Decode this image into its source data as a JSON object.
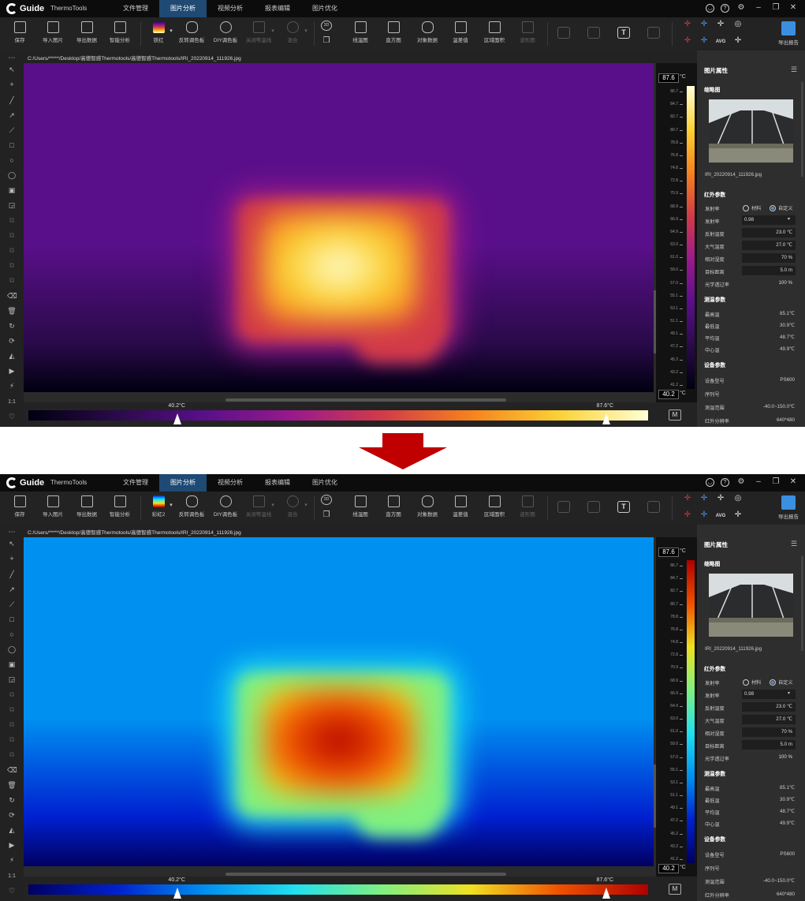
{
  "window": {
    "logo_text": "Guide",
    "app_name": "ThermoTools",
    "menu": [
      "文件管理",
      "图片分析",
      "视频分析",
      "报表编辑",
      "图片优化"
    ],
    "active_menu": 1
  },
  "toolbar": {
    "save": "保存",
    "import_image": "导入图片",
    "export_data": "导出数据",
    "smart_analysis": "智能分析",
    "invert_palette": "反转调色板",
    "diy_palette": "DIY调色板",
    "isotherm_off": "关闭等温线",
    "blend": "混合",
    "line_temp": "线温图",
    "histogram": "直方图",
    "object_data": "对象数据",
    "temp_diff": "温差值",
    "region_area": "区域面积",
    "waveform": "波形图",
    "avg_label": "AVG",
    "export_report": "导出报告",
    "icons": [
      "save-icon",
      "image-icon",
      "export-data-icon",
      "smart-analysis-icon",
      "invert-palette-icon",
      "diy-palette-icon",
      "isotherm-icon",
      "blend-icon",
      "3d-icon",
      "line-chart-icon",
      "histogram-icon",
      "database-icon",
      "delta-t-icon",
      "area-icon",
      "waveform-icon",
      "comment-icon",
      "image-frame-icon",
      "text-icon",
      "bookmark-icon",
      "crosshair-max-icon",
      "crosshair-min-icon",
      "crosshair-center-icon",
      "crosshair-min-max-icon",
      "crosshair-avg-icon",
      "target-icon",
      "settings-crosshair-icon",
      "export-report-icon"
    ]
  },
  "file_path": "C:/Users/*****/Desktop/高德智感Thermotools/高德智感Thermotools/IRI_20220914_111926.jpg",
  "scale": {
    "max": "87.6",
    "min": "40.2",
    "unit": "°C",
    "ticks": [
      "86.7",
      "84.7",
      "82.7",
      "80.7",
      "78.8",
      "76.8",
      "74.8",
      "72.8",
      "70.9",
      "68.9",
      "66.9",
      "64.9",
      "63.0",
      "61.0",
      "59.0",
      "57.0",
      "55.1",
      "53.1",
      "51.1",
      "49.1",
      "47.2",
      "45.2",
      "43.2",
      "41.2"
    ]
  },
  "span": {
    "low_label": "40.2°C",
    "high_label": "87.6°C",
    "low_fraction": 0.241,
    "high_fraction": 0.932,
    "m_button": "M"
  },
  "panel": {
    "title": "图片属性",
    "thumbnail_title": "缩略图",
    "file_name": "IRI_20220914_111926.jpg",
    "ir_params_title": "红外参数",
    "emissivity_source": "发射率",
    "material": "材料",
    "custom": "自定义",
    "emissivity": "发射率",
    "emissivity_value": "0.98",
    "reflected_temp": "反射温度",
    "reflected_temp_value": "23.0 ℃",
    "atmospheric_temp": "大气温度",
    "atmospheric_temp_value": "27.0 ℃",
    "relative_humidity": "相对湿度",
    "relative_humidity_value": "70 %",
    "target_distance": "目标距离",
    "target_distance_value": "5.0 m",
    "optical_transmission": "光学透过率",
    "optical_transmission_value": "100 %",
    "measure_title": "测温参数",
    "max_temp": "最高温",
    "max_temp_value": "85.1℃",
    "min_temp": "最低温",
    "min_temp_value": "30.9℃",
    "avg_temp": "平均温",
    "avg_temp_value": "48.7℃",
    "center_temp": "中心温",
    "center_temp_value": "49.9℃",
    "device_title": "设备参数",
    "device_model": "设备型号",
    "device_model_value": "PS600",
    "serial_number": "序列号",
    "range": "测温范围",
    "range_value": "-40.0~150.0℃",
    "resolution": "红外分辨率",
    "resolution_value": "640*480"
  },
  "views": [
    {
      "palette_name": "铁红",
      "palette_colors": [
        "#000010",
        "#2a0a4a",
        "#5a0f8a",
        "#9a1a8c",
        "#d23b48",
        "#f5821e",
        "#fbd235",
        "#ffffd8"
      ]
    },
    {
      "palette_name": "彩虹2",
      "palette_colors": [
        "#000060",
        "#0020d0",
        "#0090f0",
        "#20e0f0",
        "#80f080",
        "#f0e020",
        "#f05000",
        "#b00000"
      ]
    }
  ],
  "arrow_color": "#c00000"
}
